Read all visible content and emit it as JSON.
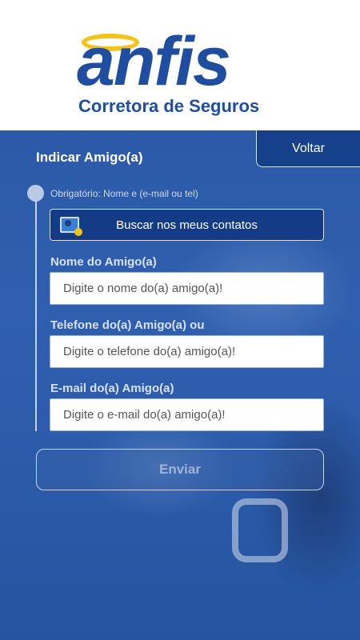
{
  "brand": {
    "logo_word": "anfis",
    "subtitle": "Corretora de Seguros",
    "primary_color": "#1f4ea0",
    "halo_color": "#f2c31b"
  },
  "nav": {
    "back_label": "Voltar"
  },
  "page": {
    "title": "Indicar Amigo(a)",
    "required_note": "Obrigatório: Nome e (e-mail ou tel)"
  },
  "contacts": {
    "button_label": "Buscar nos meus contatos",
    "icon": "contact-card-icon"
  },
  "form": {
    "name": {
      "label": "Nome do Amigo(a)",
      "placeholder": "Digite o nome do(a) amigo(a)!",
      "value": ""
    },
    "phone": {
      "label": "Telefone do(a) Amigo(a) ou",
      "placeholder": "Digite o telefone do(a) amigo(a)!",
      "value": ""
    },
    "email": {
      "label": "E-mail do(a) Amigo(a)",
      "placeholder": "Digite o e-mail do(a) amigo(a)!",
      "value": ""
    },
    "submit_label": "Enviar"
  }
}
